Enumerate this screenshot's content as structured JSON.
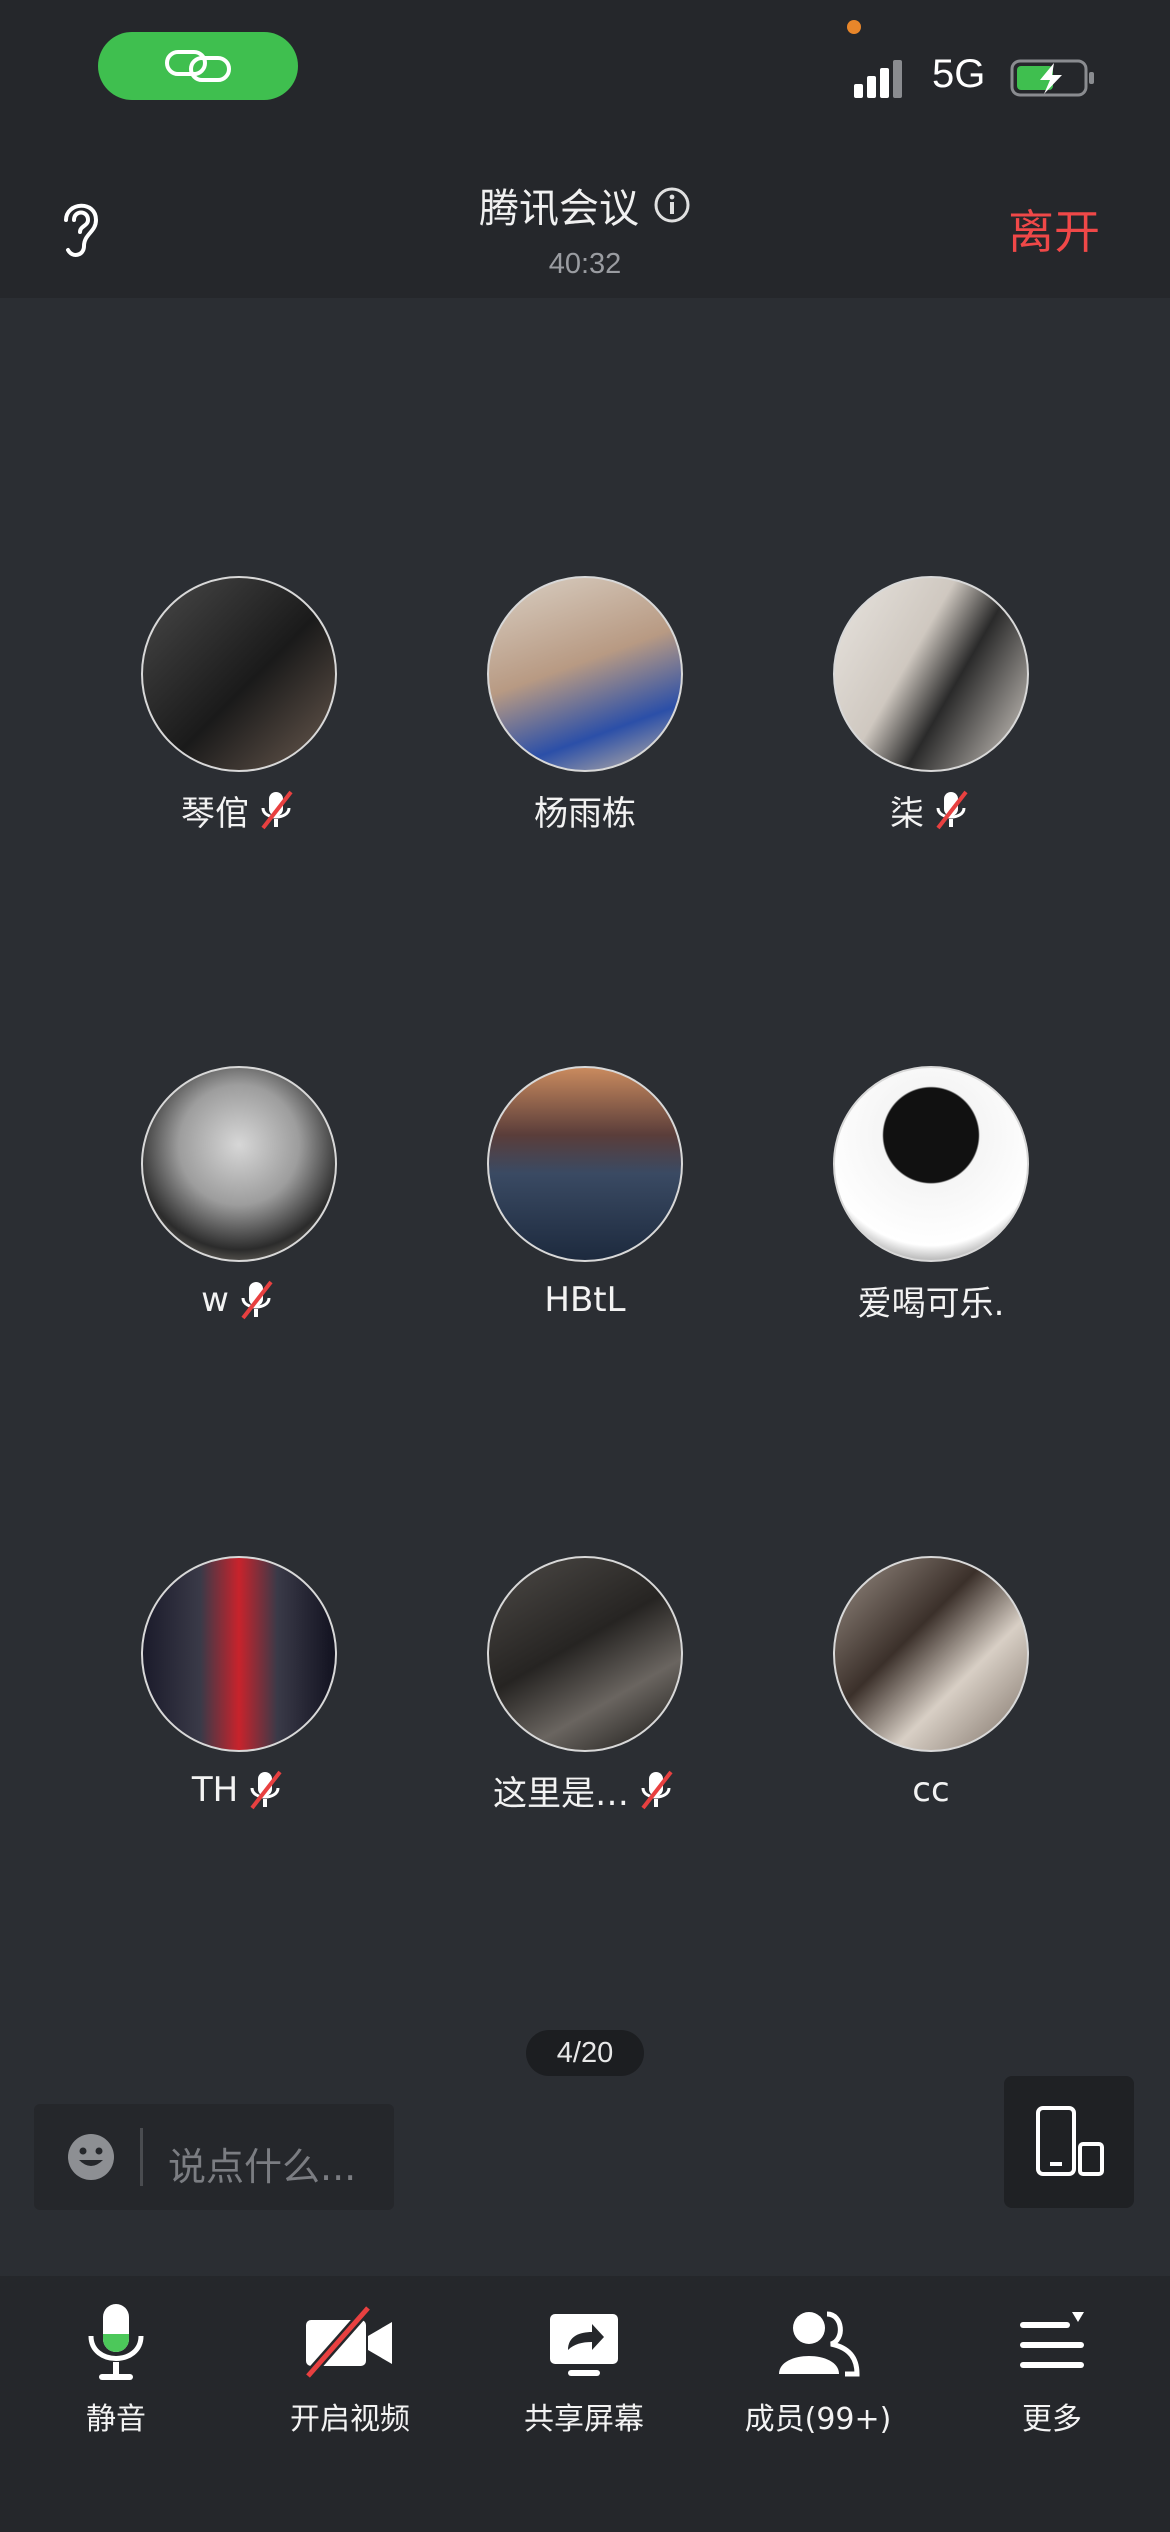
{
  "status": {
    "network": "5G"
  },
  "header": {
    "title": "腾讯会议",
    "elapsed": "40:32",
    "leave_label": "离开"
  },
  "participants": [
    {
      "name": "琴倌",
      "muted": true
    },
    {
      "name": "杨雨栋",
      "muted": false
    },
    {
      "name": "柒",
      "muted": true
    },
    {
      "name": "w",
      "muted": true
    },
    {
      "name": "HBtL",
      "muted": false
    },
    {
      "name": "爱喝可乐.",
      "muted": false
    },
    {
      "name": "TH",
      "muted": true
    },
    {
      "name": "这里是…",
      "muted": true
    },
    {
      "name": "cc",
      "muted": false
    }
  ],
  "pagination": "4/20",
  "chat": {
    "placeholder": "说点什么..."
  },
  "toolbar": {
    "mute_label": "静音",
    "video_label": "开启视频",
    "share_label": "共享屏幕",
    "members_label": "成员(99+)",
    "more_label": "更多"
  },
  "colors": {
    "accent_green": "#3fbf4f",
    "leave_red": "#f04848",
    "mute_red": "#e84040",
    "background": "#2b2e33",
    "bar": "#25272b"
  }
}
